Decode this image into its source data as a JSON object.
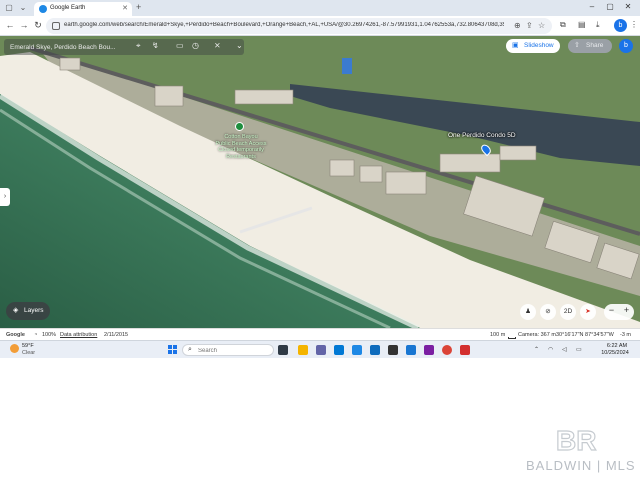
{
  "browser": {
    "tab_title": "Google Earth",
    "url": "earth.google.com/web/search/Emerald+Skye,+Perdido+Beach+Boulevard,+Orange+Beach,+AL,+USA/@30.26974261,-87.57991931,1.04762553a,732.80643708d,35y,-54.93746...",
    "icons": [
      "back-icon",
      "forward-icon",
      "reload-icon",
      "site-info-icon",
      "zoom-icon",
      "share-icon",
      "bookmark-star-icon",
      "extensions-icon",
      "downloads-icon",
      "menu-dots-icon"
    ],
    "profile_initial": "b"
  },
  "map": {
    "search_value": "Emerald Skye, Perdido Beach Bou...",
    "slideshow_label": "Slideshow",
    "share_label": "Share",
    "avatar_initial": "b",
    "poi_label_lines": [
      "Cotton Bayou",
      "Public Beach Access",
      "Closed temporarily",
      "Restaurants"
    ],
    "place_label": "One Perdido Condo 5D",
    "layers_label": "Layers",
    "view_2d_label": "2D",
    "zoom_in_label": "+",
    "zoom_out_label": "−",
    "colors": {
      "water_deep": "#2f6b52",
      "water_shallow": "#7fae95",
      "sand": "#f3efe6",
      "bay": "#3b4a55",
      "accent": "#1a73e8"
    }
  },
  "statusbar": {
    "google_label": "Google",
    "zoom_pct": "100%",
    "data_attribution": "Data attribution",
    "imagery_date": "2/11/2015",
    "scale_label": "100 m",
    "camera": "Camera: 367 m",
    "coords": "30°16'17\"N 87°34'57\"W",
    "elevation": "-3 m"
  },
  "taskbar": {
    "weather_temp": "59°F",
    "weather_cond": "Clear",
    "search_placeholder": "Search",
    "time": "6:22 AM",
    "date": "10/25/2024"
  },
  "watermark": {
    "mark_text": "BR",
    "company": "BALDWIN | MLS"
  }
}
